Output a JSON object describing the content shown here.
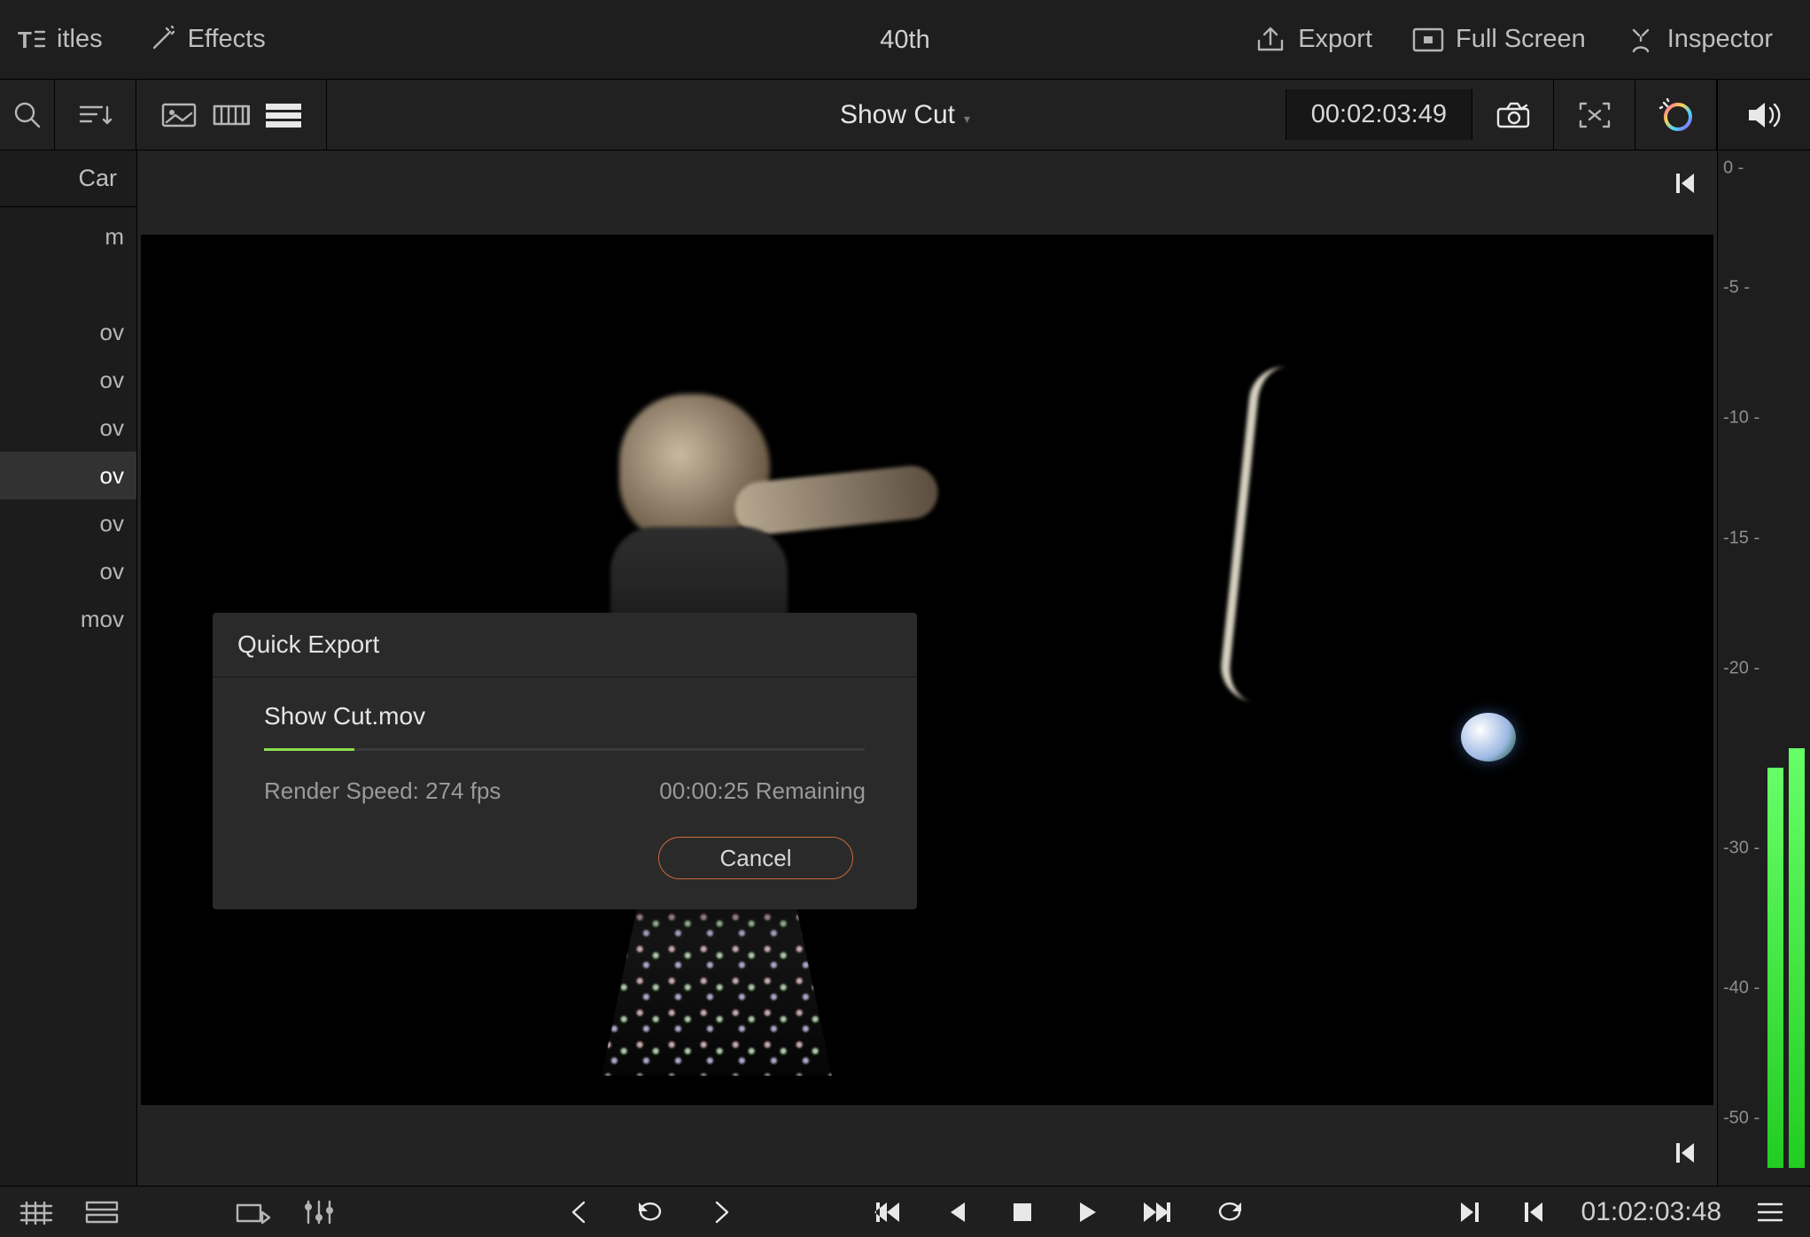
{
  "project_title": "40th",
  "top_menu": {
    "titles": "itles",
    "effects": "Effects",
    "export": "Export",
    "fullscreen": "Full Screen",
    "inspector": "Inspector"
  },
  "viewer": {
    "clip_title": "Show Cut",
    "timecode": "00:02:03:49"
  },
  "media_tab": "Car",
  "media_items": [
    {
      "label": "m"
    },
    {
      "label": ""
    },
    {
      "label": "ov"
    },
    {
      "label": "ov"
    },
    {
      "label": "ov"
    },
    {
      "label": "ov",
      "selected": true
    },
    {
      "label": "ov"
    },
    {
      "label": "ov"
    },
    {
      "label": "mov"
    }
  ],
  "audio_scale": [
    "0 -",
    "-5 -",
    "-10 -",
    "-15 -",
    "-20 -",
    "-30 -",
    "-40 -",
    "-50 -"
  ],
  "bottom_timecode": "01:02:03:48",
  "modal": {
    "title": "Quick Export",
    "filename": "Show Cut.mov",
    "render_speed": "Render Speed: 274 fps",
    "remaining": "00:00:25 Remaining",
    "progress_pct": 15,
    "cancel": "Cancel"
  }
}
